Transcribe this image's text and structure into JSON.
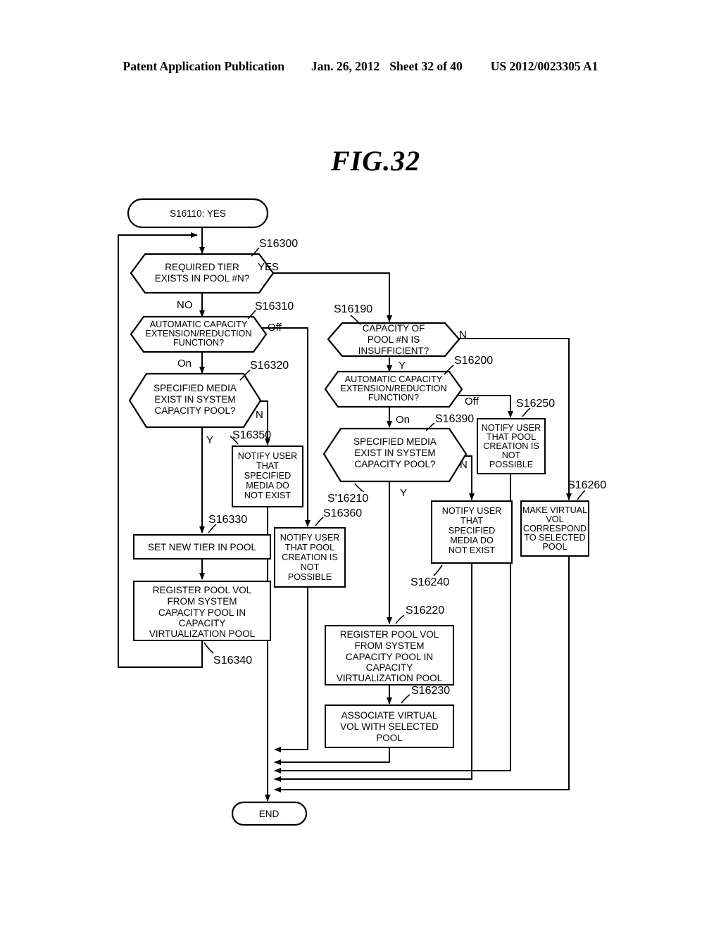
{
  "header": {
    "publication": "Patent Application Publication",
    "date": "Jan. 26, 2012",
    "sheet": "Sheet 32 of 40",
    "docnum": "US 2012/0023305 A1"
  },
  "figure": {
    "title": "FIG.32"
  },
  "diagram": {
    "type": "flowchart",
    "start": {
      "id": "start",
      "label": "S16110: YES",
      "shape": "terminator"
    },
    "end": {
      "id": "end",
      "label": "END",
      "shape": "terminator"
    },
    "nodes": [
      {
        "id": "s16300",
        "step": "S16300",
        "shape": "decision",
        "lines": [
          "REQUIRED TIER",
          "EXISTS IN POOL #N?"
        ],
        "branches": [
          "YES",
          "NO"
        ]
      },
      {
        "id": "s16310",
        "step": "S16310",
        "shape": "decision",
        "lines": [
          "AUTOMATIC CAPACITY",
          "EXTENSION/REDUCTION",
          "FUNCTION?"
        ],
        "branches": [
          "Off",
          "On"
        ]
      },
      {
        "id": "s16320",
        "step": "S16320",
        "shape": "decision",
        "lines": [
          "SPECIFIED MEDIA",
          "EXIST IN SYSTEM",
          "CAPACITY POOL?"
        ],
        "branches": [
          "N",
          "Y"
        ]
      },
      {
        "id": "s16350",
        "step": "S16350",
        "shape": "process",
        "lines": [
          "NOTIFY USER",
          "THAT",
          "SPECIFIED",
          "MEDIA DO",
          "NOT EXIST"
        ]
      },
      {
        "id": "s16330",
        "step": "S16330",
        "shape": "process",
        "lines": [
          "SET NEW TIER IN POOL"
        ]
      },
      {
        "id": "s16340",
        "step": "S16340",
        "shape": "process",
        "lines": [
          "REGISTER POOL VOL",
          "FROM SYSTEM",
          "CAPACITY POOL IN",
          "CAPACITY",
          "VIRTUALIZATION POOL"
        ]
      },
      {
        "id": "s16360",
        "step": "S16360",
        "shape": "process",
        "lines": [
          "NOTIFY USER",
          "THAT POOL",
          "CREATION IS",
          "NOT",
          "POSSIBLE"
        ]
      },
      {
        "id": "s16190",
        "step": "S16190",
        "shape": "decision",
        "lines": [
          "CAPACITY OF",
          "POOL #N IS",
          "INSUFFICIENT?"
        ],
        "branches": [
          "N",
          "Y"
        ]
      },
      {
        "id": "s16200",
        "step": "S16200",
        "shape": "decision",
        "lines": [
          "AUTOMATIC CAPACITY",
          "EXTENSION/REDUCTION",
          "FUNCTION?"
        ],
        "branches": [
          "Off",
          "On"
        ]
      },
      {
        "id": "s16390",
        "step": "S16390",
        "shape": "decision",
        "lines": [
          "SPECIFIED MEDIA",
          "EXIST IN SYSTEM",
          "CAPACITY POOL?"
        ],
        "branches": [
          "N",
          "Y"
        ],
        "alt_step": "S'16210"
      },
      {
        "id": "s16250",
        "step": "S16250",
        "shape": "process",
        "lines": [
          "NOTIFY USER",
          "THAT POOL",
          "CREATION IS",
          "NOT",
          "POSSIBLE"
        ]
      },
      {
        "id": "s16240",
        "step": "S16240",
        "shape": "process",
        "lines": [
          "NOTIFY USER",
          "THAT",
          "SPECIFIED",
          "MEDIA DO",
          "NOT EXIST"
        ]
      },
      {
        "id": "s16260",
        "step": "S16260",
        "shape": "process",
        "lines": [
          "MAKE VIRTUAL",
          "VOL",
          "CORRESPOND",
          "TO SELECTED",
          "POOL"
        ]
      },
      {
        "id": "s16220",
        "step": "S16220",
        "shape": "process",
        "lines": [
          "REGISTER POOL VOL",
          "FROM SYSTEM",
          "CAPACITY POOL IN",
          "CAPACITY",
          "VIRTUALIZATION POOL"
        ]
      },
      {
        "id": "s16230",
        "step": "S16230",
        "shape": "process",
        "lines": [
          "ASSOCIATE VIRTUAL",
          "VOL WITH SELECTED",
          "POOL"
        ]
      }
    ]
  },
  "labels": {
    "s16300_step": "S16300",
    "s16300_yes": "YES",
    "s16300_no": "NO",
    "s16310_step": "S16310",
    "s16310_off": "Off",
    "s16310_on": "On",
    "s16320_step": "S16320",
    "s16320_n": "N",
    "s16320_y": "Y",
    "s16350_step": "S16350",
    "s16330_step": "S16330",
    "s16340_step": "S16340",
    "s16360_step": "S16360",
    "s16190_step": "S16190",
    "s16190_n": "N",
    "s16190_y": "Y",
    "s16200_step": "S16200",
    "s16200_off": "Off",
    "s16200_on": "On",
    "s16390_step": "S16390",
    "s16390_alt": "S'16210",
    "s16390_n": "N",
    "s16390_y": "Y",
    "s16250_step": "S16250",
    "s16240_step": "S16240",
    "s16260_step": "S16260",
    "s16220_step": "S16220",
    "s16230_step": "S16230"
  },
  "text": {
    "start": "S16110: YES",
    "end": "END",
    "s16300_l1": "REQUIRED TIER",
    "s16300_l2": "EXISTS IN POOL #N?",
    "s16310_l1": "AUTOMATIC CAPACITY",
    "s16310_l2": "EXTENSION/REDUCTION",
    "s16310_l3": "FUNCTION?",
    "s16320_l1": "SPECIFIED MEDIA",
    "s16320_l2": "EXIST IN SYSTEM",
    "s16320_l3": "CAPACITY POOL?",
    "s16350_l1": "NOTIFY USER",
    "s16350_l2": "THAT",
    "s16350_l3": "SPECIFIED",
    "s16350_l4": "MEDIA DO",
    "s16350_l5": "NOT EXIST",
    "s16330_l1": "SET NEW TIER IN POOL",
    "s16340_l1": "REGISTER POOL VOL",
    "s16340_l2": "FROM SYSTEM",
    "s16340_l3": "CAPACITY POOL IN",
    "s16340_l4": "CAPACITY",
    "s16340_l5": "VIRTUALIZATION POOL",
    "s16360_l1": "NOTIFY USER",
    "s16360_l2": "THAT POOL",
    "s16360_l3": "CREATION IS",
    "s16360_l4": "NOT",
    "s16360_l5": "POSSIBLE",
    "s16190_l1": "CAPACITY OF",
    "s16190_l2": "POOL #N IS",
    "s16190_l3": "INSUFFICIENT?",
    "s16200_l1": "AUTOMATIC CAPACITY",
    "s16200_l2": "EXTENSION/REDUCTION",
    "s16200_l3": "FUNCTION?",
    "s16390_l1": "SPECIFIED MEDIA",
    "s16390_l2": "EXIST IN SYSTEM",
    "s16390_l3": "CAPACITY POOL?",
    "s16250_l1": "NOTIFY USER",
    "s16250_l2": "THAT POOL",
    "s16250_l3": "CREATION IS",
    "s16250_l4": "NOT",
    "s16250_l5": "POSSIBLE",
    "s16240_l1": "NOTIFY USER",
    "s16240_l2": "THAT",
    "s16240_l3": "SPECIFIED",
    "s16240_l4": "MEDIA DO",
    "s16240_l5": "NOT EXIST",
    "s16260_l1": "MAKE VIRTUAL",
    "s16260_l2": "VOL",
    "s16260_l3": "CORRESPOND",
    "s16260_l4": "TO SELECTED",
    "s16260_l5": "POOL",
    "s16220_l1": "REGISTER POOL VOL",
    "s16220_l2": "FROM SYSTEM",
    "s16220_l3": "CAPACITY POOL IN",
    "s16220_l4": "CAPACITY",
    "s16220_l5": "VIRTUALIZATION POOL",
    "s16230_l1": "ASSOCIATE VIRTUAL",
    "s16230_l2": "VOL WITH SELECTED",
    "s16230_l3": "POOL"
  },
  "colors": {
    "ink": "#000000",
    "paper": "#ffffff"
  }
}
